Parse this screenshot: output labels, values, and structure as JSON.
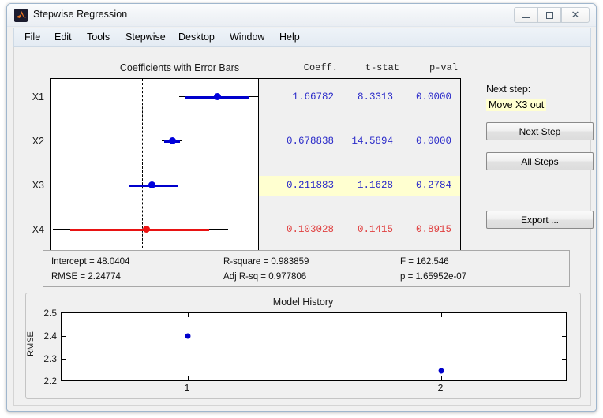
{
  "window": {
    "title": "Stepwise Regression",
    "icon": "matlab-icon",
    "minimize_label": "",
    "maximize_label": "",
    "close_label": "✕"
  },
  "menu": {
    "items": [
      {
        "label": "File"
      },
      {
        "label": "Edit"
      },
      {
        "label": "Tools"
      },
      {
        "label": "Stepwise"
      },
      {
        "label": "Desktop"
      },
      {
        "label": "Window"
      },
      {
        "label": "Help"
      }
    ]
  },
  "coefficients_panel": {
    "title": "Coefficients with Error Bars",
    "columns": [
      "Coeff.",
      "t-stat",
      "p-val"
    ],
    "xticks": [
      "-1",
      "0",
      "1",
      "2"
    ],
    "rows": [
      {
        "label": "X1",
        "coeff": "1.66782",
        "tstat": "8.3313",
        "pval": "0.0000",
        "state": "in",
        "highlight": false,
        "value": 1.66782,
        "ci_inner": [
          1.27,
          2.06
        ],
        "ci_outer": [
          1.18,
          2.15
        ]
      },
      {
        "label": "X2",
        "coeff": "0.678838",
        "tstat": "14.5894",
        "pval": "0.0000",
        "state": "in",
        "highlight": false,
        "value": 0.678838,
        "ci_inner": [
          0.585,
          0.775
        ],
        "ci_outer": [
          0.565,
          0.795
        ]
      },
      {
        "label": "X3",
        "coeff": "0.211883",
        "tstat": "1.1628",
        "pval": "0.2784",
        "state": "in",
        "highlight": true,
        "value": 0.211883,
        "ci_inner": [
          -0.17,
          0.6
        ],
        "ci_outer": [
          -0.24,
          0.66
        ]
      },
      {
        "label": "X4",
        "coeff": "0.103028",
        "tstat": "0.1415",
        "pval": "0.8915",
        "state": "out",
        "highlight": false,
        "value": 0.103028,
        "ci_inner": [
          -1.3,
          1.5
        ],
        "ci_outer": [
          -1.63,
          1.84
        ]
      }
    ]
  },
  "next_step": {
    "label": "Next step:",
    "value": "Move X3 out",
    "buttons": [
      {
        "label": "Next Step"
      },
      {
        "label": "All Steps"
      },
      {
        "label": "Export ..."
      }
    ]
  },
  "stats": {
    "intercept": "Intercept = 48.0404",
    "rmse": "RMSE = 2.24774",
    "rsquare": "R-square = 0.983859",
    "adj_rsq": "Adj R-sq = 0.977806",
    "f": "F = 162.546",
    "p": "p = 1.65952e-07"
  },
  "chart_data": {
    "type": "scatter",
    "title": "Model History",
    "xlabel": "",
    "ylabel": "RMSE",
    "x": [
      1,
      2
    ],
    "values": [
      2.4,
      2.248
    ],
    "xticklabels": [
      "1",
      "2"
    ],
    "yticklabels": [
      "2.2",
      "2.3",
      "2.4",
      "2.5"
    ],
    "xlim": [
      0.5,
      2.5
    ],
    "ylim": [
      2.2,
      2.5
    ],
    "grid": false,
    "legend": null,
    "marker_color": "#0000cc"
  },
  "colors": {
    "in_model": "#2b2bc9",
    "out_model": "#e04040",
    "highlight": "#ffffd0",
    "panel": "#f0f0f0"
  }
}
